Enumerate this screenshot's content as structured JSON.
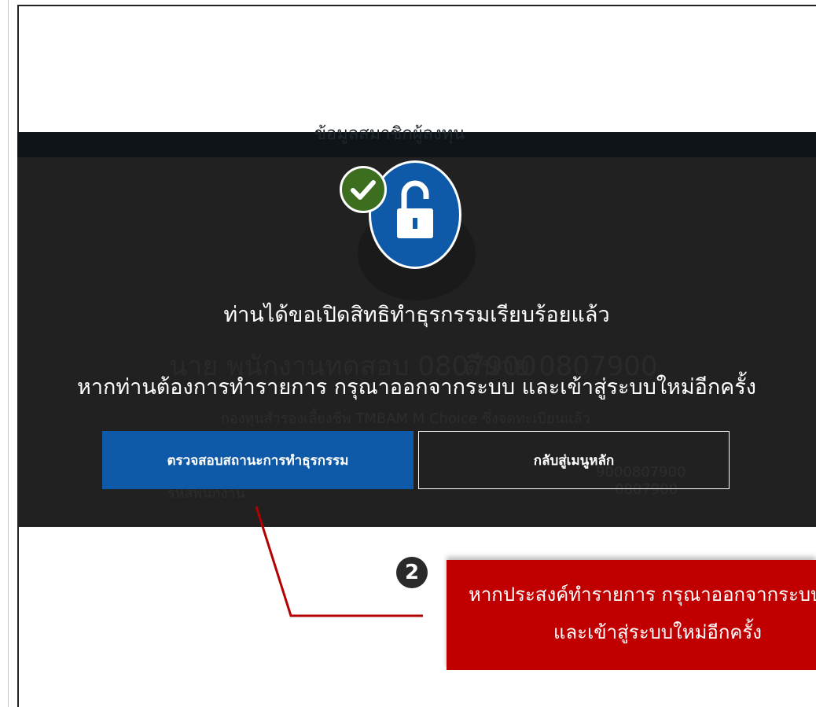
{
  "background": {
    "strip_text": "ข้อมูลสมาชิกผู้ลงทุน",
    "member_name": "นาย พนักงานทดสอบ 0807900",
    "member_name_suffix": "ดีนาย 0807900",
    "fund_name": "กองทุนสำรองเลี้ยงชีพ TMBAM M Choice ซึ่งจดทะเบียนแล้ว",
    "member_number": "9000807900",
    "employee_code_label": "รหัสพนักงาน",
    "employee_code": "0807900"
  },
  "dialog": {
    "title": "ท่านได้ขอเปิดสิทธิทำธุรกรรมเรียบร้อยแล้ว",
    "message": "หากท่านต้องการทำรายการ กรุณาออกจากระบบ และเข้าสู่ระบบใหม่อีกครั้ง",
    "primary_button": "ตรวจสอบสถานะการทำธุรกรรม",
    "secondary_button": "กลับสู่เมนูหลัก",
    "icons": {
      "status": "check-icon",
      "main": "unlock-icon"
    },
    "colors": {
      "panel": "#212121",
      "primary": "#0f5aa8",
      "check": "#3d6e1f"
    }
  },
  "annotation": {
    "step_number": "2",
    "note_line1": "หากประสงค์ทำรายการ กรุณาออกจากระบบ",
    "note_line2": "และเข้าสู่ระบบใหม่อีกครั้ง",
    "color": "#c00000"
  }
}
